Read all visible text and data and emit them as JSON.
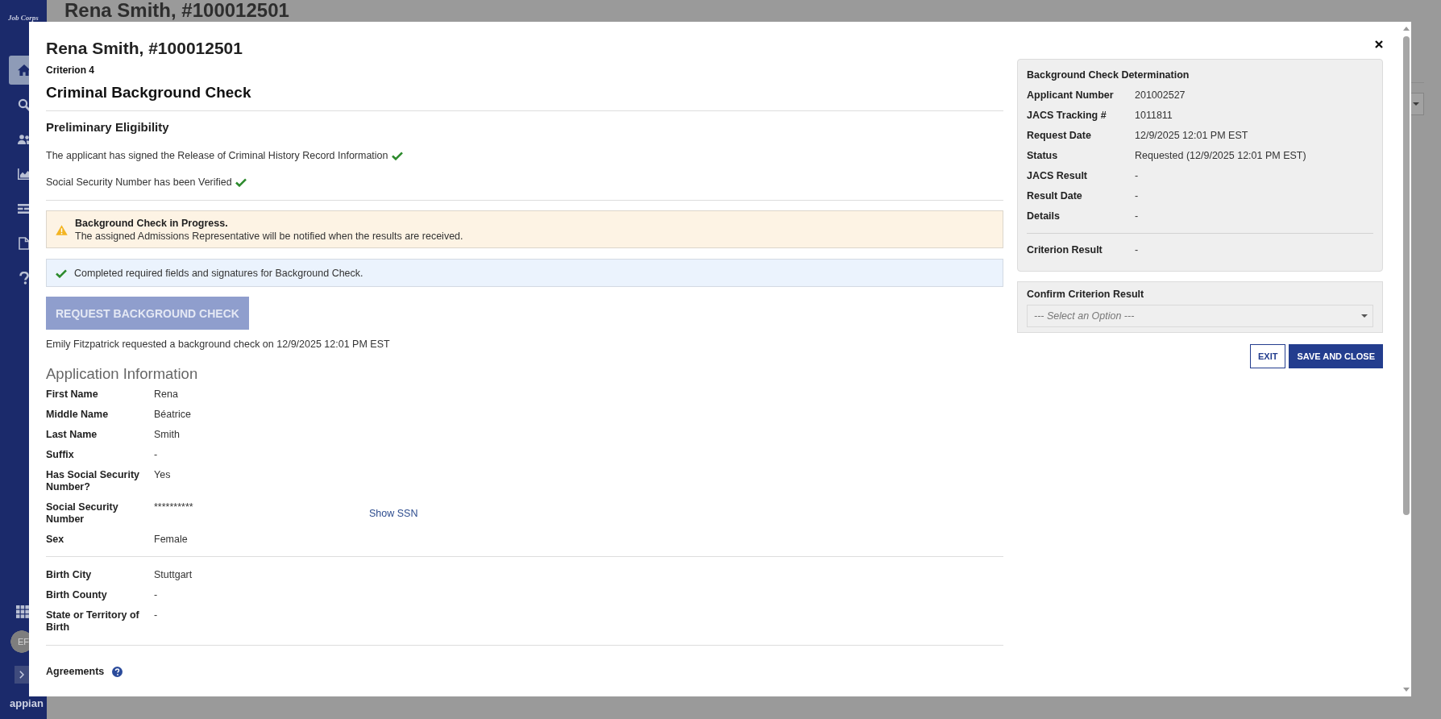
{
  "background_page": {
    "title": "Rena Smith, #100012501"
  },
  "sidebar": {
    "logo": "Job Corps",
    "items": [
      {
        "kind": "home",
        "selected": true
      },
      {
        "kind": "search",
        "selected": false
      },
      {
        "kind": "people",
        "selected": false
      },
      {
        "kind": "chart",
        "selected": false
      },
      {
        "kind": "list",
        "selected": false
      },
      {
        "kind": "document",
        "selected": false
      },
      {
        "kind": "help",
        "selected": false
      }
    ],
    "avatar": "EF",
    "brand": "appian"
  },
  "modal": {
    "title": "Rena Smith, #100012501",
    "criterion": "Criterion 4",
    "heading": "Criminal Background Check",
    "preliminary": {
      "heading": "Preliminary Eligibility",
      "items": [
        {
          "text": "The applicant has signed the Release of Criminal History Record Information",
          "verified": true
        },
        {
          "text": "Social Security Number has been Verified",
          "verified": true
        }
      ]
    },
    "alerts": [
      {
        "kind": "warning",
        "title": "Background Check in Progress.",
        "message": "The assigned Admissions Representative will be notified when the results are received."
      },
      {
        "kind": "success",
        "message": "Completed required fields and signatures for Background Check."
      }
    ],
    "request_button": {
      "label": "REQUEST BACKGROUND CHECK",
      "disabled": true
    },
    "request_note": "Emily Fitzpatrick requested a background check on 12/9/2025 12:01 PM EST",
    "application": {
      "heading": "Application Information",
      "groups": [
        {
          "fields": [
            {
              "label": "First Name",
              "value": "Rena"
            },
            {
              "label": "Middle Name",
              "value": "Béatrice"
            },
            {
              "label": "Last Name",
              "value": "Smith"
            },
            {
              "label": "Suffix",
              "value": "-"
            },
            {
              "label": "Has Social Security Number?",
              "value": "Yes"
            },
            {
              "label": "Social Security Number",
              "value": "**********",
              "link": "Show SSN"
            },
            {
              "label": "Sex",
              "value": "Female"
            }
          ]
        },
        {
          "fields": [
            {
              "label": "Birth City",
              "value": "Stuttgart"
            },
            {
              "label": "Birth County",
              "value": "-"
            },
            {
              "label": "State or Territory of Birth",
              "value": "-"
            }
          ]
        }
      ]
    },
    "agreements": {
      "label": "Agreements"
    },
    "determination": {
      "title": "Background Check Determination",
      "fields": [
        {
          "label": "Applicant Number",
          "value": "201002527"
        },
        {
          "label": "JACS Tracking #",
          "value": "1011811"
        },
        {
          "label": "Request Date",
          "value": "12/9/2025 12:01 PM EST"
        },
        {
          "label": "Status",
          "value": "Requested (12/9/2025 12:01 PM EST)"
        },
        {
          "label": "JACS Result",
          "value": "-"
        },
        {
          "label": "Result Date",
          "value": "-"
        },
        {
          "label": "Details",
          "value": "-"
        }
      ],
      "result": {
        "label": "Criterion Result",
        "value": "-"
      }
    },
    "confirm": {
      "label": "Confirm Criterion Result",
      "placeholder": "--- Select an Option ---"
    },
    "buttons": [
      {
        "label": "EXIT",
        "kind": "secondary"
      },
      {
        "label": "SAVE AND CLOSE",
        "kind": "primary"
      }
    ]
  }
}
